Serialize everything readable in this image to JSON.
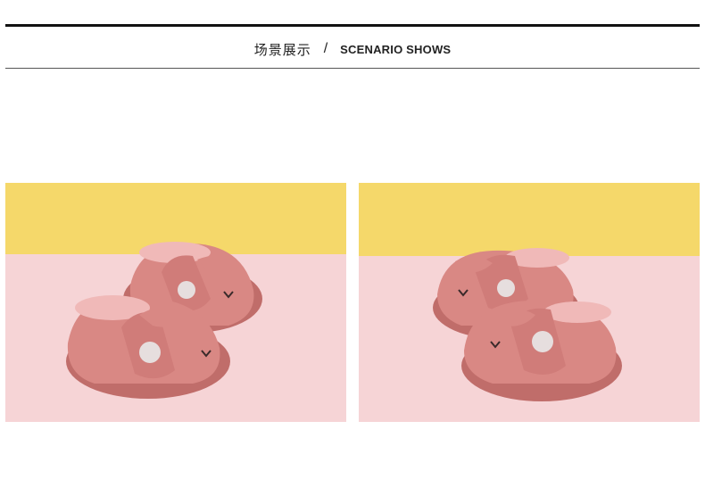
{
  "header": {
    "title_cn": "场景展示",
    "separator": "/",
    "title_en": "SCENARIO SHOWS"
  },
  "colors": {
    "rule": "#111111",
    "wall_yellow": "#f5d86a",
    "floor_pink": "#f6d4d6",
    "slipper": "#d98884",
    "slipper_dark": "#c06d6a",
    "fleece": "#f0b9b8"
  },
  "gallery": [
    {
      "name": "scene-photo-left",
      "subject": "pair of pink plush slippers with bunny ears"
    },
    {
      "name": "scene-photo-right",
      "subject": "pair of pink plush slippers with bunny ears"
    }
  ]
}
